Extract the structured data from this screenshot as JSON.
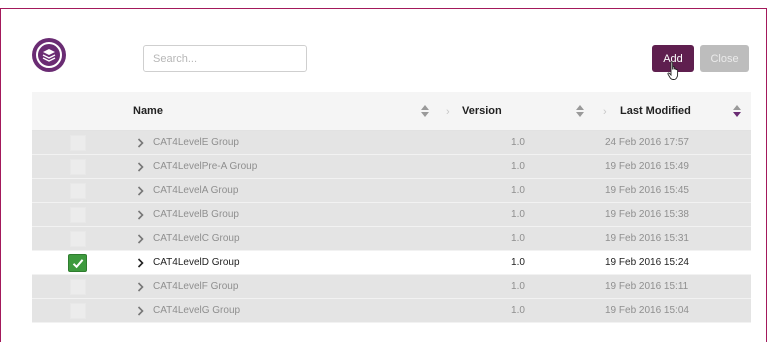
{
  "toolbar": {
    "search_placeholder": "Search...",
    "add_label": "Add",
    "close_label": "Close"
  },
  "table": {
    "headers": {
      "name": "Name",
      "version": "Version",
      "modified": "Last Modified"
    },
    "rows": [
      {
        "name": "CAT4LevelE Group",
        "version": "1.0",
        "modified": "24 Feb 2016 17:57",
        "selected": false
      },
      {
        "name": "CAT4LevelPre-A Group",
        "version": "1.0",
        "modified": "19 Feb 2016 15:49",
        "selected": false
      },
      {
        "name": "CAT4LevelA Group",
        "version": "1.0",
        "modified": "19 Feb 2016 15:45",
        "selected": false
      },
      {
        "name": "CAT4LevelB Group",
        "version": "1.0",
        "modified": "19 Feb 2016 15:38",
        "selected": false
      },
      {
        "name": "CAT4LevelC Group",
        "version": "1.0",
        "modified": "19 Feb 2016 15:31",
        "selected": false
      },
      {
        "name": "CAT4LevelD Group",
        "version": "1.0",
        "modified": "19 Feb 2016 15:24",
        "selected": true
      },
      {
        "name": "CAT4LevelF Group",
        "version": "1.0",
        "modified": "19 Feb 2016 15:11",
        "selected": false
      },
      {
        "name": "CAT4LevelG Group",
        "version": "1.0",
        "modified": "19 Feb 2016 15:04",
        "selected": false
      }
    ]
  },
  "colors": {
    "frame": "#a3195b",
    "logo": "#6a2c73",
    "add_button": "#5f1f4f",
    "close_button": "#bdbdbd",
    "check": "#3e9a3e"
  },
  "icons": {
    "logo": "layers-logo-icon",
    "sort": "sort-arrows-icon",
    "row_expand": "chevron-right-icon",
    "checked": "checkmark-icon",
    "cursor": "hand-pointer-icon"
  }
}
